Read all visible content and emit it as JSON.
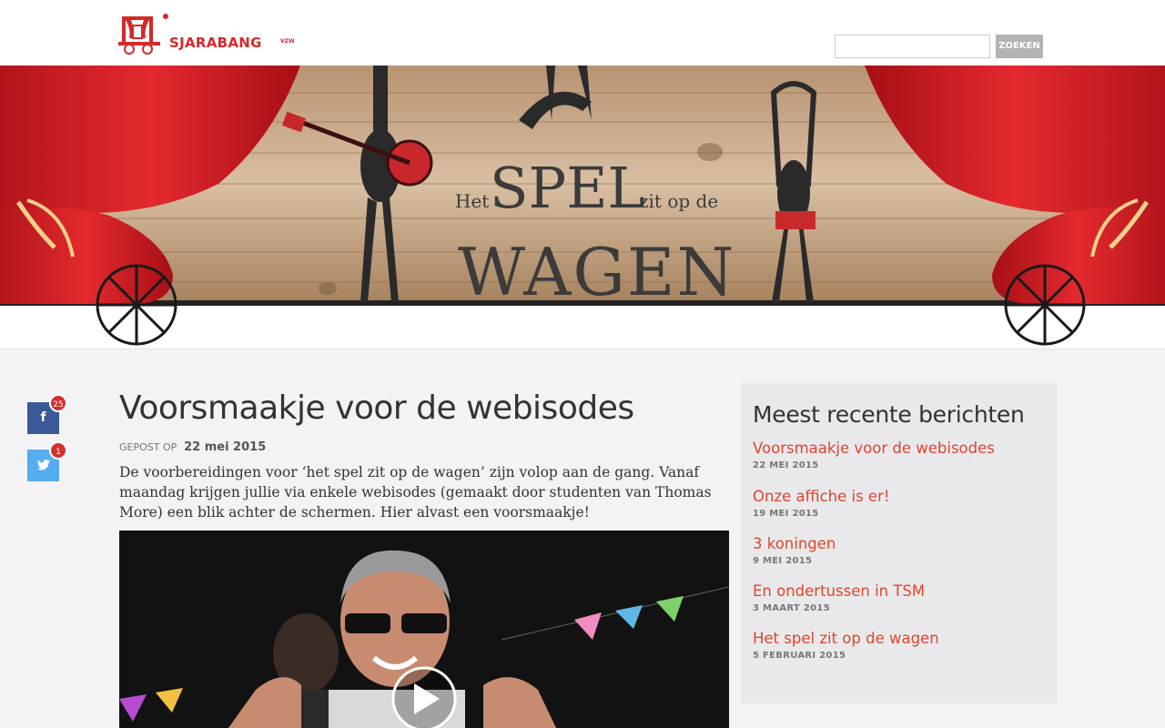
{
  "brand": {
    "name": "SJARABANG",
    "suffix": "VZW"
  },
  "search": {
    "button_label": "ZOEKEN",
    "value": ""
  },
  "banner": {
    "line1_prefix": "Het",
    "line1_big": "SPEL",
    "line1_suffix": "zit op de",
    "line2": "WAGEN"
  },
  "share": {
    "facebook_count": "25",
    "twitter_count": "1",
    "facebook_icon": "facebook-icon",
    "twitter_icon": "twitter-icon"
  },
  "post": {
    "title": "Voorsmaakje voor de webisodes",
    "meta_label": "GEPOST OP",
    "date": "22 mei 2015",
    "body": "De voorbereidingen voor ‘het spel zit op de wagen’ zijn volop aan de gang. Vanaf maandag krijgen jullie via enkele webisodes (gemaakt door studenten van Thomas More) een blik achter de schermen. Hier alvast een voorsmaakje!"
  },
  "sidebar": {
    "title": "Meest recente berichten",
    "items": [
      {
        "title": "Voorsmaakje voor de webisodes",
        "date": "22 MEI 2015"
      },
      {
        "title": "Onze affiche is er!",
        "date": "19 MEI 2015"
      },
      {
        "title": "3 koningen",
        "date": "9 MEI 2015"
      },
      {
        "title": "En ondertussen in TSM",
        "date": "3 MAART 2015"
      },
      {
        "title": "Het spel zit op de wagen",
        "date": "5 FEBRUARI 2015"
      }
    ]
  },
  "colors": {
    "accent": "#e0452a",
    "brand_red": "#d42a2a",
    "facebook": "#3b5998",
    "twitter": "#55acee"
  }
}
